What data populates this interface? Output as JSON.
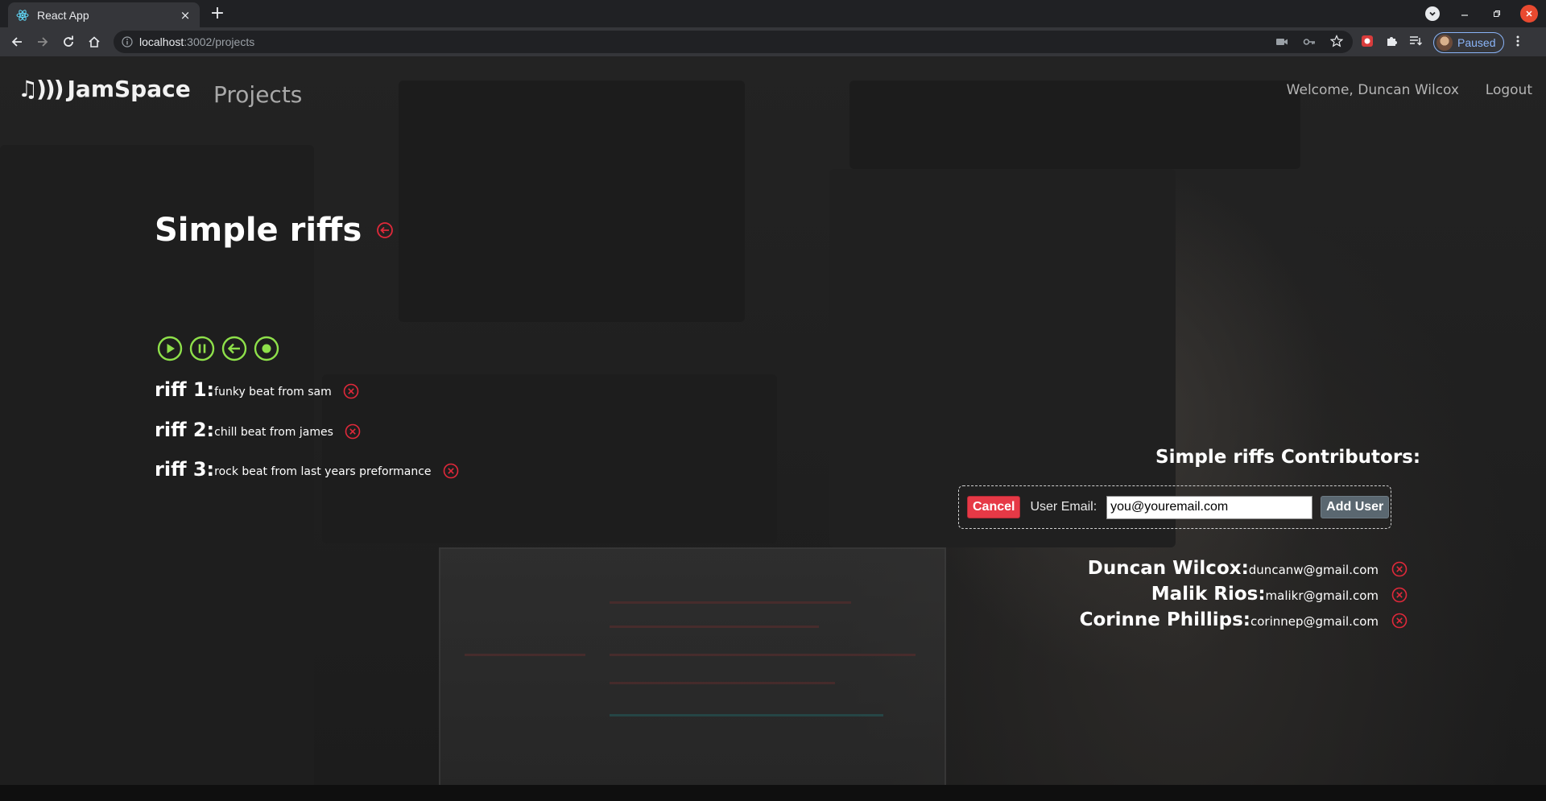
{
  "browser": {
    "tab_title": "React App",
    "tab_close": "×",
    "new_tab": "+",
    "url_host": "localhost",
    "url_path": ":3002/projects",
    "profile_status": "Paused"
  },
  "navbar": {
    "brand_icon": "♫)))",
    "brand_name": "JamSpace",
    "projects_link": "Projects",
    "welcome_text": "Welcome, Duncan Wilcox",
    "logout_link": "Logout"
  },
  "project": {
    "title": "Simple riffs",
    "controls": [
      "play-icon",
      "pause-icon",
      "back-icon",
      "record-icon"
    ],
    "riffs": [
      {
        "name": "riff 1:",
        "description": "funky beat from sam"
      },
      {
        "name": "riff 2:",
        "description": "chill beat from james"
      },
      {
        "name": "riff 3:",
        "description": "rock beat from last years preformance"
      }
    ]
  },
  "contributors": {
    "title": "Simple riffs Contributors:",
    "form": {
      "cancel_label": "Cancel",
      "email_label": "User Email:",
      "email_value": "you@youremail.com",
      "add_label": "Add User"
    },
    "list": [
      {
        "name": "Duncan Wilcox:",
        "email": "duncanw@gmail.com"
      },
      {
        "name": "Malik Rios:",
        "email": "malikr@gmail.com"
      },
      {
        "name": "Corinne Phillips:",
        "email": "corinnep@gmail.com"
      }
    ]
  },
  "colors": {
    "accent_green": "#8ee04a",
    "delete_red": "#e0293a",
    "cancel_red": "#e63946",
    "add_gray": "#5a6770"
  }
}
